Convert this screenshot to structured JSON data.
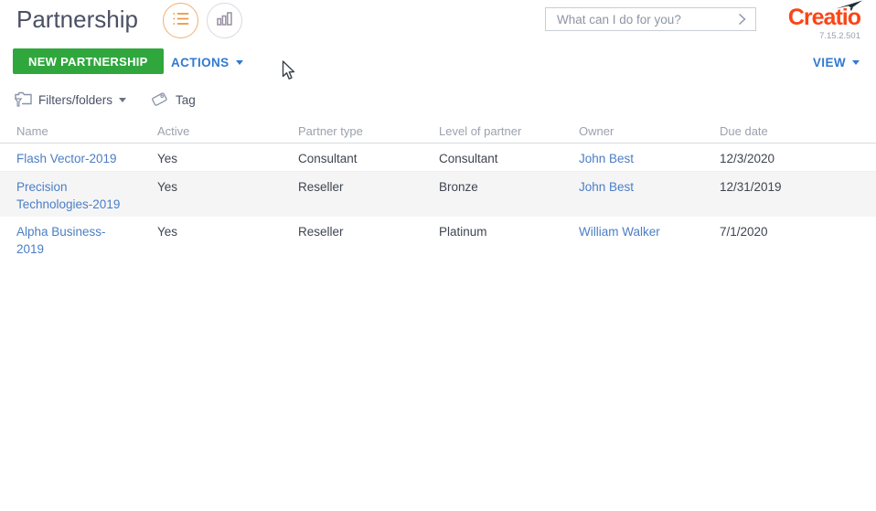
{
  "header": {
    "title": "Partnership",
    "search": {
      "placeholder": "What can I do for you?"
    },
    "logo": {
      "text": "Creatio",
      "version": "7.15.2.501"
    }
  },
  "toolbar": {
    "new_button": "NEW PARTNERSHIP",
    "actions": "ACTIONS",
    "view": "VIEW"
  },
  "filter_bar": {
    "filters": "Filters/folders",
    "tag": "Tag"
  },
  "table": {
    "columns": [
      "Name",
      "Active",
      "Partner type",
      "Level of partner",
      "Owner",
      "Due date"
    ],
    "rows": [
      {
        "name": "Flash Vector-2019",
        "active": "Yes",
        "partner_type": "Consultant",
        "level": "Consultant",
        "owner": "John Best",
        "due_date": "12/3/2020"
      },
      {
        "name": "Precision Technologies-2019",
        "active": "Yes",
        "partner_type": "Reseller",
        "level": "Bronze",
        "owner": "John Best",
        "due_date": "12/31/2019"
      },
      {
        "name": "Alpha Business-2019",
        "active": "Yes",
        "partner_type": "Reseller",
        "level": "Platinum",
        "owner": "William Walker",
        "due_date": "7/1/2020"
      }
    ]
  },
  "icons": {
    "list_view": "list-icon",
    "analytics_view": "bar-chart-icon",
    "search_submit": "chevron-right-icon",
    "filters": "folder-funnel-icon",
    "tag": "tag-icon",
    "dropdown": "caret-down-icon",
    "logo_plane": "paper-plane-icon"
  },
  "colors": {
    "accent_green": "#2FA73D",
    "link_blue_toolbar": "#3179D1",
    "link_blue_table": "#4B7EC5",
    "brand_orange": "#FB4516",
    "icon_orange": "#E8973F",
    "icon_gray": "#8A93A8",
    "selected_row_bg": "#F5F5F6"
  }
}
